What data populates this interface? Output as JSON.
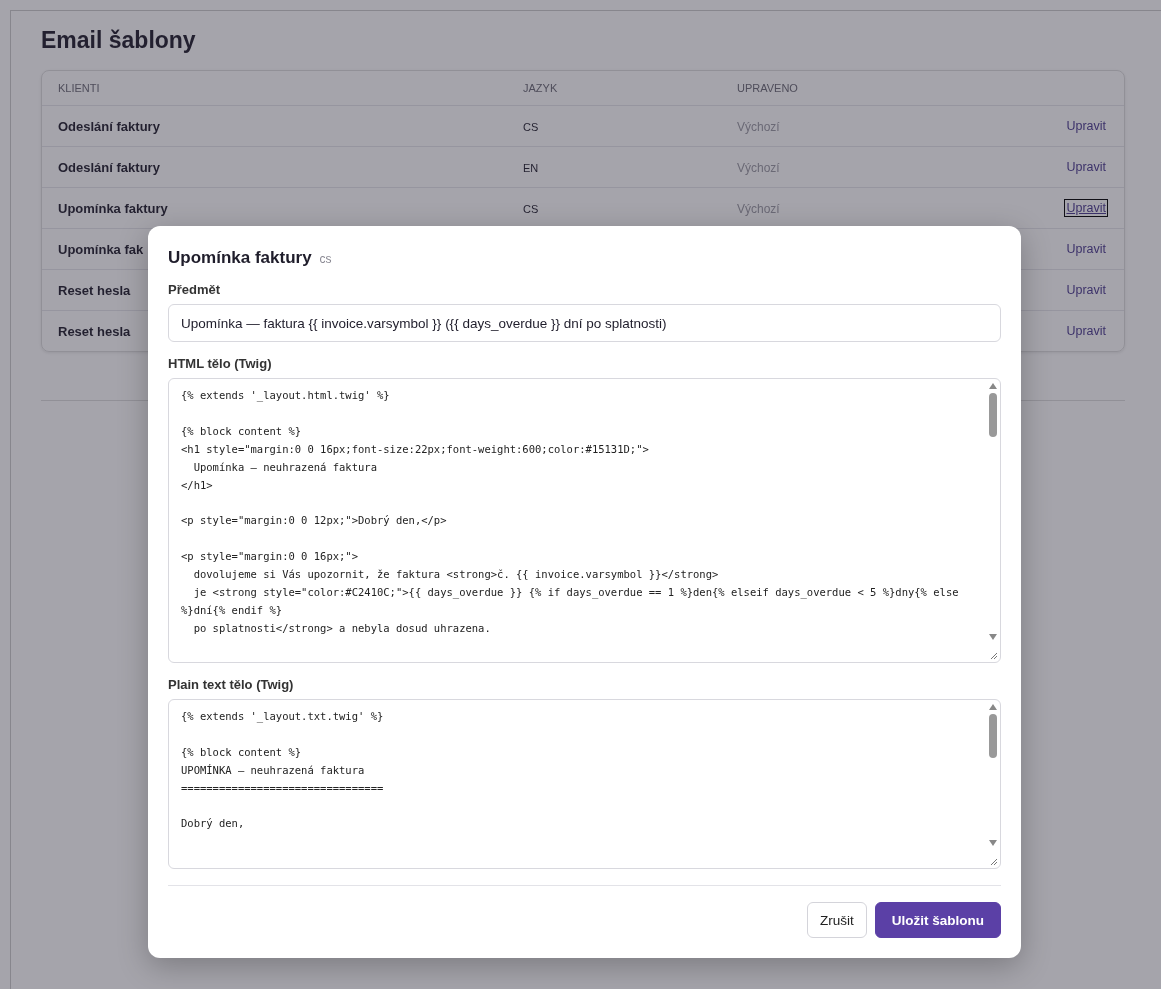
{
  "page": {
    "title": "Email šablony"
  },
  "table": {
    "columns": [
      "KLIENTI",
      "JAZYK",
      "UPRAVENO"
    ],
    "rows": [
      {
        "name": "Odeslání faktury",
        "language": "CS",
        "modified": "Výchozí",
        "action": "Upravit",
        "focused": false
      },
      {
        "name": "Odeslání faktury",
        "language": "EN",
        "modified": "Výchozí",
        "action": "Upravit",
        "focused": false
      },
      {
        "name": "Upomínka faktury",
        "language": "CS",
        "modified": "Výchozí",
        "action": "Upravit",
        "focused": true
      },
      {
        "name": "Upomínka fak",
        "action": "Upravit",
        "focused": false
      },
      {
        "name": "Reset hesla",
        "action": "Upravit",
        "focused": false
      },
      {
        "name": "Reset hesla",
        "action": "Upravit",
        "focused": false
      }
    ]
  },
  "modal": {
    "title": "Upomínka faktury",
    "badge": "cs",
    "subject_label": "Předmět",
    "subject_value": "Upomínka — faktura {{ invoice.varsymbol }} ({{ days_overdue }} dní po splatnosti)",
    "html_label": "HTML tělo (Twig)",
    "html_value": "{% extends '_layout.html.twig' %}\n\n{% block content %}\n<h1 style=\"margin:0 0 16px;font-size:22px;font-weight:600;color:#15131D;\">\n  Upomínka – neuhrazená faktura\n</h1>\n\n<p style=\"margin:0 0 12px;\">Dobrý den,</p>\n\n<p style=\"margin:0 0 16px;\">\n  dovolujeme si Vás upozornit, že faktura <strong>č. {{ invoice.varsymbol }}</strong>\n  je <strong style=\"color:#C2410C;\">{{ days_overdue }} {% if days_overdue == 1 %}den{% elseif days_overdue < 5 %}dny{% else\n%}dní{% endif %}\n  po splatnosti</strong> a nebyla dosud uhrazena.",
    "plain_label": "Plain text tělo (Twig)",
    "plain_value": "{% extends '_layout.txt.twig' %}\n\n{% block content %}\nUPOMÍNKA – neuhrazená faktura\n================================\n\nDobrý den,",
    "buttons": [
      {
        "label": "Zrušit",
        "kind": "secondary"
      },
      {
        "label": "Uložit šablonu",
        "kind": "primary"
      }
    ]
  }
}
